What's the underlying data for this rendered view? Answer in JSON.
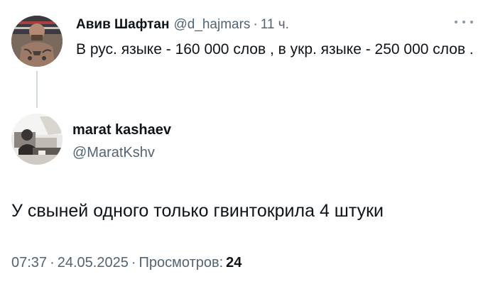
{
  "parent_tweet": {
    "author_name": "Авив Шафтан",
    "author_handle": "@d_hajmars",
    "separator": "·",
    "time": "11 ч.",
    "text": "В рус. языке - 160 000 слов , в укр. языке - 250 000 слов .",
    "avatar_icon": "person-photo-icon",
    "more_icon": "more-options-icon"
  },
  "main_tweet": {
    "author_name": "marat kashaev",
    "author_handle": "@MaratKshv",
    "avatar_icon": "person-photo-icon",
    "text": "У свыней одного только гвинтокрила 4 штуки",
    "time": "07:37",
    "separator": "·",
    "date": "24.05.2025",
    "views_label": "Просмотров:",
    "views_count": "24"
  },
  "colors": {
    "text_primary": "#0f1419",
    "text_secondary": "#536471",
    "thread_line": "#cfd9de",
    "background": "#ffffff"
  }
}
